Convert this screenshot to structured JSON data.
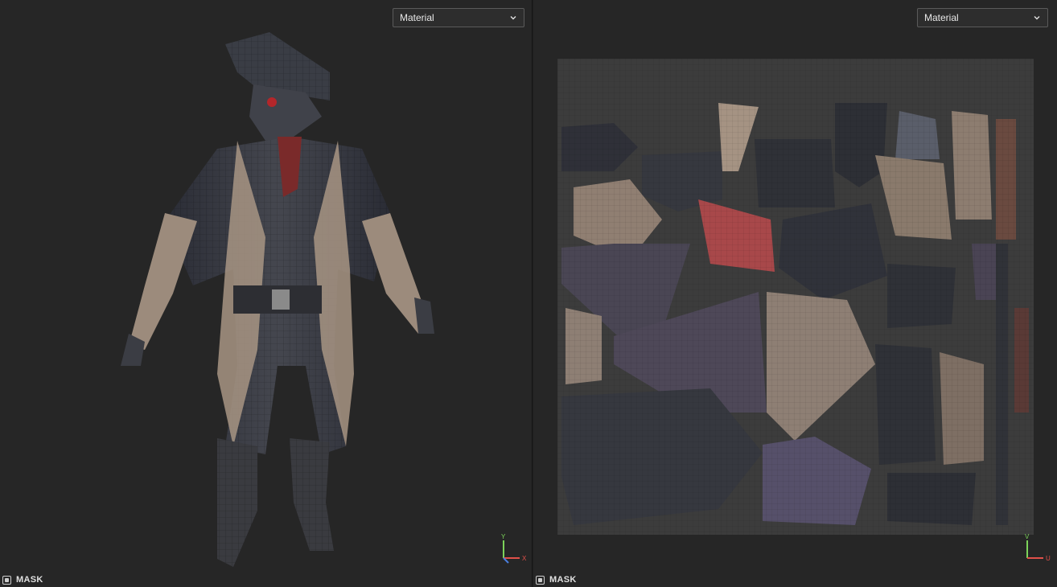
{
  "viewport_3d": {
    "mode_dropdown": {
      "value": "Material"
    },
    "mask": {
      "label": "MASK"
    },
    "gizmo": {
      "y_axis": "Y",
      "x_axis": "X"
    }
  },
  "viewport_2d": {
    "mode_dropdown": {
      "value": "Material"
    },
    "mask": {
      "label": "MASK"
    },
    "gizmo": {
      "v_axis": "V",
      "u_axis": "U"
    }
  },
  "colors": {
    "panel_bg": "#262626",
    "dropdown_border": "#5a5a5a",
    "axis_y": "#7cd35a",
    "axis_x": "#e0504a",
    "axis_z": "#4a7fe0"
  }
}
